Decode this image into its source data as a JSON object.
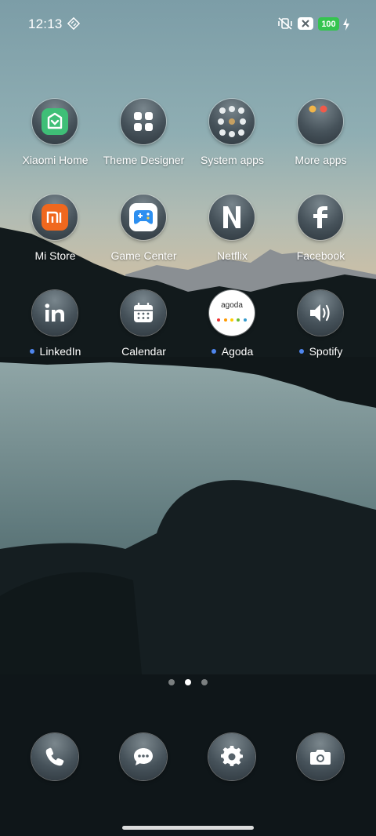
{
  "status_bar": {
    "time": "12:13",
    "battery_level": "100",
    "battery_color": "#35c44f",
    "icons": [
      "nfc-icon",
      "mute-vibrate-icon",
      "sim-off-icon",
      "charging-icon"
    ]
  },
  "apps": [
    {
      "label": "Xiaomi Home",
      "icon": "mi-home-icon",
      "new": false
    },
    {
      "label": "Theme Designer",
      "icon": "grid-icon",
      "new": false
    },
    {
      "label": "System apps",
      "icon": "folder-icon",
      "new": false
    },
    {
      "label": "More apps",
      "icon": "folder-icon",
      "new": false
    },
    {
      "label": "Mi Store",
      "icon": "mi-logo-icon",
      "new": false
    },
    {
      "label": "Game Center",
      "icon": "gamepad-icon",
      "new": false
    },
    {
      "label": "Netflix",
      "icon": "netflix-icon",
      "new": false
    },
    {
      "label": "Facebook",
      "icon": "facebook-icon",
      "new": false
    },
    {
      "label": "LinkedIn",
      "icon": "linkedin-icon",
      "new": true
    },
    {
      "label": "Calendar",
      "icon": "calendar-icon",
      "new": false
    },
    {
      "label": "Agoda",
      "icon": "agoda-icon",
      "new": true,
      "logo_text": "agoda"
    },
    {
      "label": "Spotify",
      "icon": "speaker-icon",
      "new": true
    }
  ],
  "page_indicator": {
    "pages": 3,
    "current": 2
  },
  "dock": [
    {
      "icon": "phone-icon"
    },
    {
      "icon": "messages-icon"
    },
    {
      "icon": "settings-icon"
    },
    {
      "icon": "camera-icon"
    }
  ],
  "colors": {
    "new_dot": "#4f86ee",
    "mi_home_green": "#3fbf77",
    "mi_store_orange": "#f0681e",
    "game_blue": "#2d8ff0"
  }
}
